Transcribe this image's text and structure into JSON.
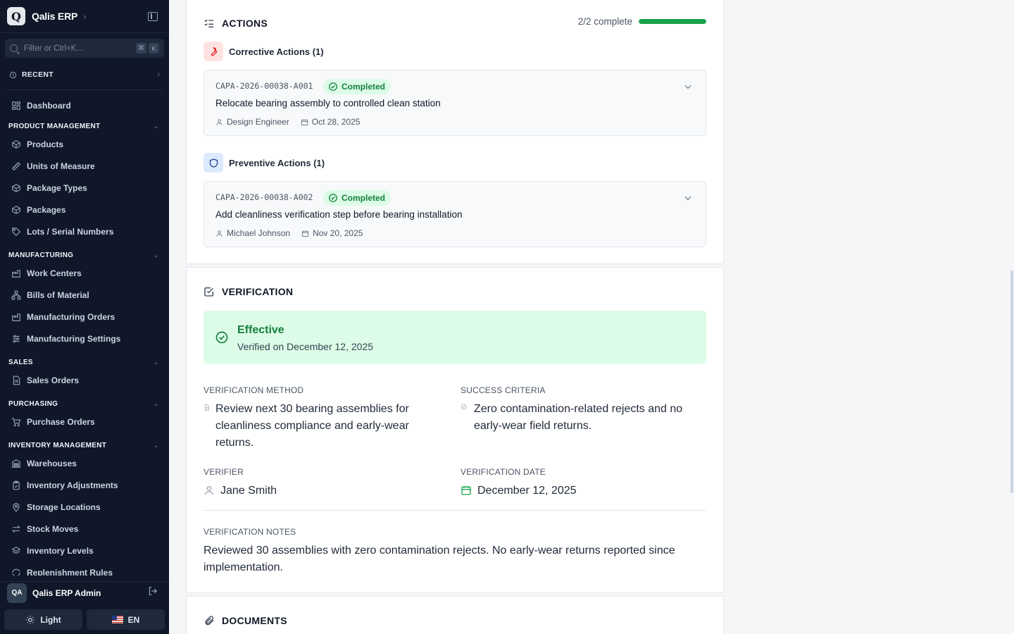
{
  "app": {
    "name": "Qalis ERP",
    "logo_letter": "Q"
  },
  "search": {
    "placeholder": "Filter or Ctrl+K...",
    "kbd1": "⌘",
    "kbd2": "K"
  },
  "recent": {
    "label": "RECENT"
  },
  "nav": {
    "dashboard": "Dashboard",
    "sections": {
      "product": "PRODUCT MANAGEMENT",
      "manufacturing": "MANUFACTURING",
      "sales": "SALES",
      "purchasing": "PURCHASING",
      "inventory": "INVENTORY MANAGEMENT"
    },
    "items": {
      "products": "Products",
      "uom": "Units of Measure",
      "package_types": "Package Types",
      "packages": "Packages",
      "lots": "Lots / Serial Numbers",
      "work_centers": "Work Centers",
      "boms": "Bills of Material",
      "mos": "Manufacturing Orders",
      "mfg_settings": "Manufacturing Settings",
      "sales_orders": "Sales Orders",
      "purchase_orders": "Purchase Orders",
      "warehouses": "Warehouses",
      "inv_adjust": "Inventory Adjustments",
      "storage": "Storage Locations",
      "stock_moves": "Stock Moves",
      "inv_levels": "Inventory Levels",
      "replenish": "Replenishment Rules"
    }
  },
  "user": {
    "initials": "QA",
    "name": "Qalis ERP Admin"
  },
  "footer": {
    "theme_label": "Light",
    "lang_label": "EN"
  },
  "actions": {
    "title": "ACTIONS",
    "progress_text": "2/2 complete",
    "progress_fraction": 1.0,
    "corrective": {
      "heading": "Corrective Actions (1)",
      "items": [
        {
          "code": "CAPA-2026-00038-A001",
          "status": "Completed",
          "title": "Relocate bearing assembly to controlled clean station",
          "owner": "Design Engineer",
          "date": "Oct 28, 2025"
        }
      ]
    },
    "preventive": {
      "heading": "Preventive Actions (1)",
      "items": [
        {
          "code": "CAPA-2026-00038-A002",
          "status": "Completed",
          "title": "Add cleanliness verification step before bearing installation",
          "owner": "Michael Johnson",
          "date": "Nov 20, 2025"
        }
      ]
    }
  },
  "verification": {
    "title": "VERIFICATION",
    "result": "Effective",
    "result_sub": "Verified on December 12, 2025",
    "method_label": "VERIFICATION METHOD",
    "method_value": "Review next 30 bearing assemblies for cleanliness compliance and early-wear returns.",
    "criteria_label": "SUCCESS CRITERIA",
    "criteria_value": "Zero contamination-related rejects and no early-wear field returns.",
    "verifier_label": "VERIFIER",
    "verifier_value": "Jane Smith",
    "date_label": "VERIFICATION DATE",
    "date_value": "December 12, 2025",
    "notes_label": "VERIFICATION NOTES",
    "notes_value": "Reviewed 30 assemblies with zero contamination rejects. No early-wear returns reported since implementation."
  },
  "documents": {
    "title": "DOCUMENTS"
  },
  "colors": {
    "sidebar_bg": "#0f1729",
    "success": "#16a34a",
    "success_bg": "#dcfce7",
    "corrective_accent": "#dc2626",
    "preventive_accent": "#1e3a8a"
  }
}
